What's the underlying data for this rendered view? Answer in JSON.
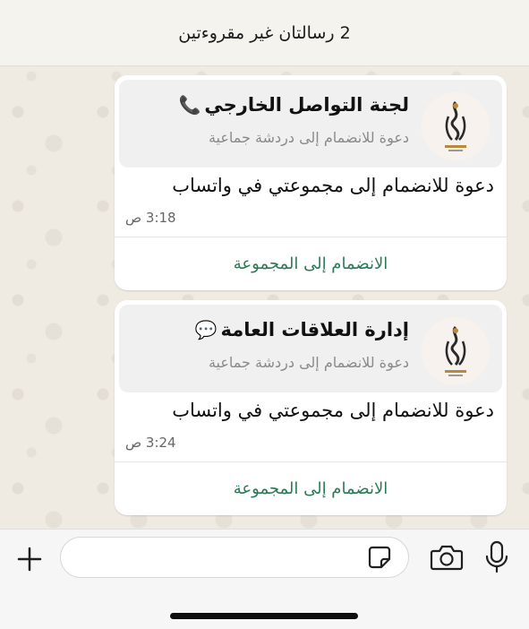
{
  "banner": {
    "unread_text": "2 رسالتان غير مقروءتين"
  },
  "messages": [
    {
      "group_name": "لجنة التواصل الخارجي",
      "name_emoji": "📞",
      "subtitle": "دعوة للانضمام إلى دردشة جماعية",
      "invite_text": "دعوة للانضمام إلى مجموعتي في واتساب",
      "time": "3:18 ص",
      "join_label": "الانضمام إلى المجموعة",
      "avatar_icon": "group-logo-icon"
    },
    {
      "group_name": "إدارة العلاقات العامة",
      "name_emoji": "💬",
      "subtitle": "دعوة للانضمام إلى دردشة جماعية",
      "invite_text": "دعوة للانضمام إلى مجموعتي في واتساب",
      "time": "3:24 ص",
      "join_label": "الانضمام إلى المجموعة",
      "avatar_icon": "group-logo-icon"
    }
  ],
  "composer": {
    "value": "",
    "icons": [
      "plus-icon",
      "sticker-icon",
      "camera-icon",
      "microphone-icon"
    ]
  },
  "colors": {
    "join_link": "#2b7a55",
    "bubble": "#ffffff",
    "card": "#f0f0f0",
    "chat_background": "#efeae2"
  }
}
